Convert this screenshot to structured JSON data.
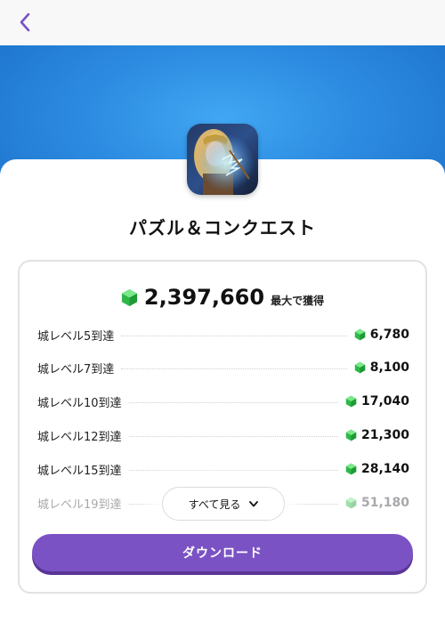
{
  "app": {
    "title": "パズル＆コンクエスト"
  },
  "reward": {
    "total": "2,397,660",
    "total_suffix": "最大で獲得",
    "gem_icon": "green-gem-icon",
    "gem_color": "#35c84a"
  },
  "milestones": [
    {
      "label": "城レベル5到達",
      "amount": "6,780"
    },
    {
      "label": "城レベル7到達",
      "amount": "8,100"
    },
    {
      "label": "城レベル10到達",
      "amount": "17,040"
    },
    {
      "label": "城レベル12到達",
      "amount": "21,300"
    },
    {
      "label": "城レベル15到達",
      "amount": "28,140"
    },
    {
      "label": "城レベル19到達",
      "amount": "51,180"
    }
  ],
  "buttons": {
    "see_all": "すべて見る",
    "download": "ダウンロード"
  },
  "colors": {
    "accent": "#7b52c4",
    "hero_blue": "#2c8be0",
    "back_arrow": "#7b52c4"
  }
}
